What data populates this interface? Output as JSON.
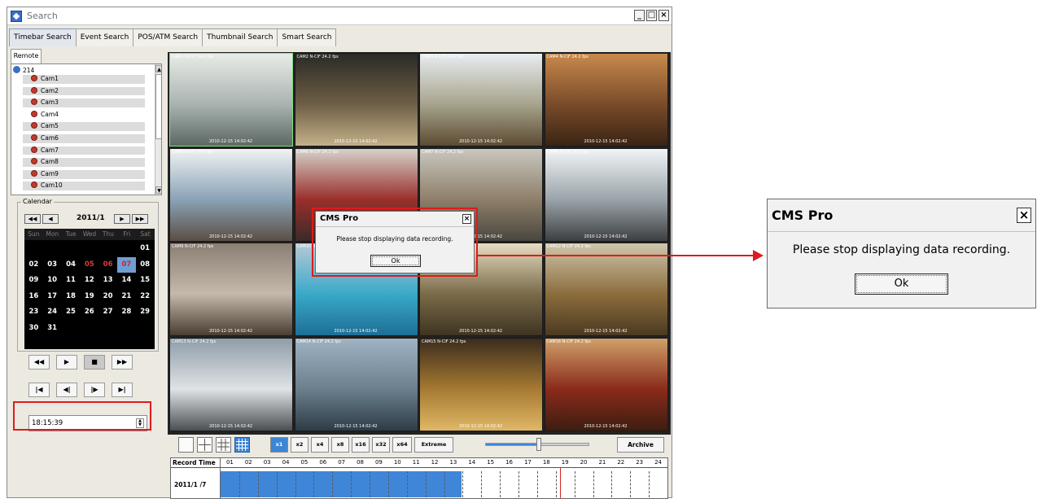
{
  "window": {
    "title": "Search",
    "minimize": "_",
    "maximize": "□",
    "close": "×"
  },
  "tabs": [
    "Timebar Search",
    "Event Search",
    "POS/ATM Search",
    "Thumbnail Search",
    "Smart Search"
  ],
  "remote_tab": "Remote",
  "tree": {
    "root": "214",
    "cameras": [
      "Cam1",
      "Cam2",
      "Cam3",
      "Cam4",
      "Cam5",
      "Cam6",
      "Cam7",
      "Cam8",
      "Cam9",
      "Cam10"
    ],
    "selected": "Cam4"
  },
  "calendar": {
    "label": "Calendar",
    "month": "2011/1",
    "weekdays": [
      "Sun",
      "Mon",
      "Tue",
      "Wed",
      "Thu",
      "Fri",
      "Sat"
    ],
    "days": [
      "01",
      "02",
      "03",
      "04",
      "05",
      "06",
      "07",
      "08",
      "09",
      "10",
      "11",
      "12",
      "13",
      "14",
      "15",
      "16",
      "17",
      "18",
      "19",
      "20",
      "21",
      "22",
      "23",
      "24",
      "25",
      "26",
      "27",
      "28",
      "29",
      "30",
      "31"
    ],
    "first_weekday_index": 6,
    "red_days": [
      "05",
      "06"
    ],
    "selected_day": "07",
    "nav": {
      "first": "◀◀",
      "prev": "◀",
      "next": "▶",
      "last": "▶▶"
    }
  },
  "playback": {
    "row1": [
      "◀◀",
      "▶",
      "■",
      "▶▶"
    ],
    "row2": [
      "|◀",
      "◀|",
      "|▶",
      "▶|"
    ]
  },
  "time_value": "18:15:39",
  "cameras_grid": [
    {
      "label": "CAM1 N-CIF 24.2 fps",
      "timestamp": "2010-12-15  14:02:42",
      "colors": [
        "#e9ece8",
        "#a9b3b0",
        "#5d6864"
      ]
    },
    {
      "label": "CAM2 N-CIF 24.2 fps",
      "timestamp": "2010-12-15  14:02:42",
      "colors": [
        "#2a2a27",
        "#6e5e45",
        "#c4b08a"
      ]
    },
    {
      "label": "CAM3 N-CIF 24.2 fps",
      "timestamp": "2010-12-15  14:02:42",
      "colors": [
        "#e8edf1",
        "#a7a38c",
        "#5c4b32"
      ]
    },
    {
      "label": "CAM4 N-CIF 24.2 fps",
      "timestamp": "2010-12-15  14:02:42",
      "colors": [
        "#c98a4c",
        "#7a4b2a",
        "#3a2413"
      ]
    },
    {
      "label": "CAM5 N-CIF 24.2 fps",
      "timestamp": "2010-12-15  14:02:42",
      "colors": [
        "#f1f2f3",
        "#8aa3b6",
        "#5b4e43"
      ]
    },
    {
      "label": "CAM6 N-CIF 24.2 fps",
      "timestamp": "2010-12-15  14:02:42",
      "colors": [
        "#d5d2cc",
        "#9a2f2a",
        "#3a2a2a"
      ]
    },
    {
      "label": "CAM7 N-CIF 24.2 fps",
      "timestamp": "2010-12-15  14:02:42",
      "colors": [
        "#c9c7bf",
        "#8e7f6a",
        "#4a463f"
      ]
    },
    {
      "label": "CAM8 N-CIF 24.2 fps",
      "timestamp": "2010-12-15  14:02:42",
      "colors": [
        "#f2f5f6",
        "#9aa4aa",
        "#3d3f41"
      ]
    },
    {
      "label": "CAM9 N-CIF 24.2 fps",
      "timestamp": "2010-12-15  14:02:42",
      "colors": [
        "#8a7f73",
        "#c4b9aa",
        "#4a3d33"
      ]
    },
    {
      "label": "CAM10 N-CIF 24.2 fps",
      "timestamp": "2010-12-15  14:02:42",
      "colors": [
        "#b7c9d6",
        "#3aa9c8",
        "#1d6f96"
      ]
    },
    {
      "label": "CAM11 N-CIF 24.2 fps",
      "timestamp": "2010-12-15  14:02:42",
      "colors": [
        "#e6ddc3",
        "#7a6b49",
        "#3e3422"
      ]
    },
    {
      "label": "CAM12 N-CIF 24.2 fps",
      "timestamp": "2010-12-15  14:02:42",
      "colors": [
        "#cfc6ad",
        "#8c6d3d",
        "#4b3a22"
      ]
    },
    {
      "label": "CAM13 N-CIF 24.2 fps",
      "timestamp": "2010-12-15  14:02:42",
      "colors": [
        "#8f9da8",
        "#dfe3e6",
        "#4a4f53"
      ]
    },
    {
      "label": "CAM14 N-CIF 24.2 fps",
      "timestamp": "2010-12-15  14:02:42",
      "colors": [
        "#9fb3c3",
        "#6b7f8d",
        "#2d3c47"
      ]
    },
    {
      "label": "CAM15 N-CIF 24.2 fps",
      "timestamp": "2010-12-15  14:02:42",
      "colors": [
        "#3b2c1d",
        "#a67a32",
        "#e0b866"
      ]
    },
    {
      "label": "CAM16 N-CIF 24.2 fps",
      "timestamp": "2010-12-15  14:02:42",
      "colors": [
        "#d0a06a",
        "#8a2b1b",
        "#3d1d10"
      ]
    }
  ],
  "speed_buttons": [
    "x1",
    "x2",
    "x4",
    "x8",
    "x16",
    "x32",
    "x64",
    "Extreme"
  ],
  "active_speed": "x1",
  "archive_label": "Archive",
  "timeline": {
    "label": "Record Time",
    "hours": [
      "01",
      "02",
      "03",
      "04",
      "05",
      "06",
      "07",
      "08",
      "09",
      "10",
      "11",
      "12",
      "13",
      "14",
      "15",
      "16",
      "17",
      "18",
      "19",
      "20",
      "21",
      "22",
      "23",
      "24"
    ],
    "date": "2011/1 /7",
    "recorded_fraction": 0.54,
    "cursor_fraction": 0.76
  },
  "dialog": {
    "title": "CMS Pro",
    "message": "Please stop displaying data recording.",
    "ok": "Ok",
    "close": "×"
  },
  "colors": {
    "highlight": "#e01b1b",
    "accent": "#3d86d6"
  }
}
